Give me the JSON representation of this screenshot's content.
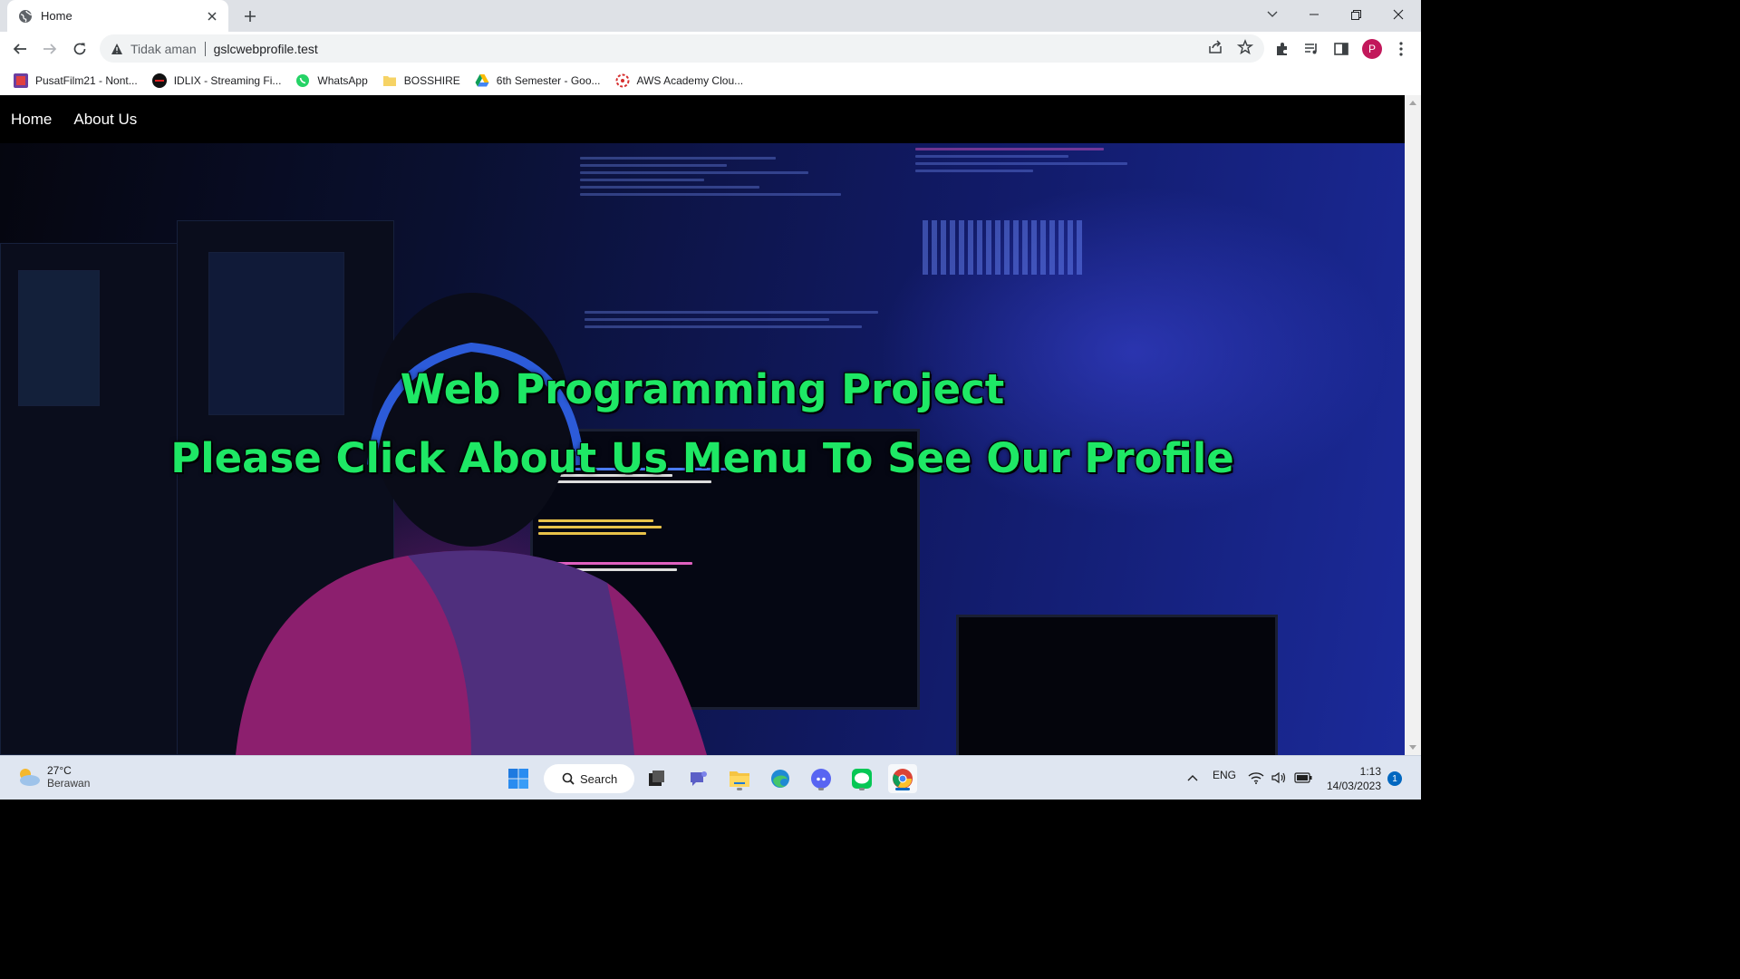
{
  "browser": {
    "tab": {
      "title": "Home"
    },
    "address": {
      "security_label": "Tidak aman",
      "url": "gslcwebprofile.test"
    },
    "profile_initial": "P",
    "bookmarks": [
      {
        "label": "PusatFilm21 - Nont...",
        "icon": "pusatfilm-icon"
      },
      {
        "label": "IDLIX - Streaming Fi...",
        "icon": "idlix-icon"
      },
      {
        "label": "WhatsApp",
        "icon": "whatsapp-icon"
      },
      {
        "label": "BOSSHIRE",
        "icon": "folder-icon"
      },
      {
        "label": "6th Semester - Goo...",
        "icon": "google-drive-icon"
      },
      {
        "label": "AWS Academy Clou...",
        "icon": "aws-academy-icon"
      }
    ]
  },
  "site": {
    "nav": {
      "home": "Home",
      "about": "About Us"
    },
    "hero": {
      "title": "Web Programming Project",
      "subtitle": "Please Click About Us Menu To See Our Profile",
      "text_color": "#1ee865"
    }
  },
  "taskbar": {
    "weather": {
      "temp": "27°C",
      "condition": "Berawan"
    },
    "search_label": "Search",
    "language": "ENG",
    "time": "1:13",
    "date": "14/03/2023",
    "notification_count": "1"
  }
}
